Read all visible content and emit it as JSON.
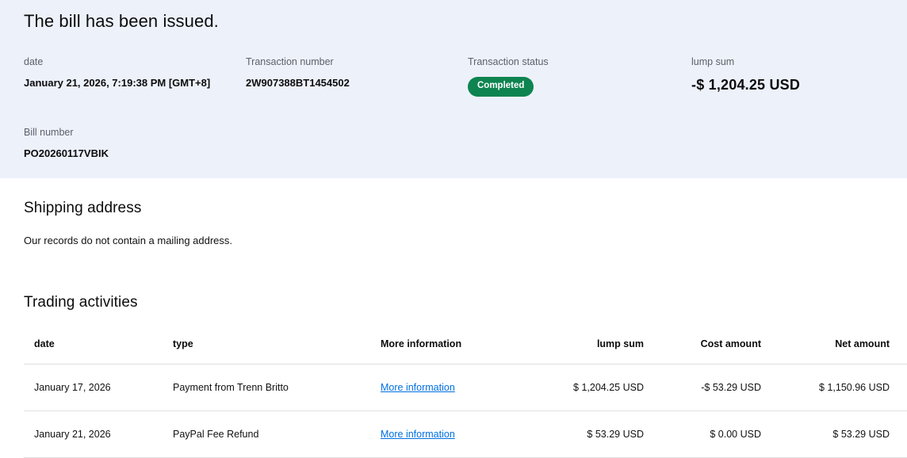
{
  "header": {
    "title": "The bill has been issued.",
    "fields": [
      {
        "label": "date",
        "value": "January 21, 2026, 7:19:38 PM [GMT+8]"
      },
      {
        "label": "Transaction number",
        "value": "2W907388BT1454502"
      },
      {
        "label": "Transaction status",
        "value": "Completed"
      },
      {
        "label": "lump sum",
        "value": "-$ 1,204.25 USD"
      },
      {
        "label": "Bill number",
        "value": "PO20260117VBIK"
      }
    ]
  },
  "shipping": {
    "title": "Shipping address",
    "message": "Our records do not contain a mailing address."
  },
  "trading": {
    "title": "Trading activities",
    "columns": {
      "date": "date",
      "type": "type",
      "more_info": "More information",
      "lump_sum": "lump sum",
      "cost": "Cost amount",
      "net": "Net amount"
    },
    "rows": [
      {
        "date": "January 17, 2026",
        "type": "Payment from Trenn Britto",
        "more_info": "More information",
        "lump_sum": "$ 1,204.25 USD",
        "cost": "-$ 53.29 USD",
        "net": "$ 1,150.96 USD"
      },
      {
        "date": "January 21, 2026",
        "type": "PayPal Fee Refund",
        "more_info": "More information",
        "lump_sum": "$ 53.29 USD",
        "cost": "$ 0.00 USD",
        "net": "$ 53.29 USD"
      }
    ]
  },
  "colors": {
    "hero_background": "#edf1fa",
    "status_badge_green": "#0e8450",
    "link_blue": "#0070e0",
    "divider_gray": "#e0e0e0"
  }
}
